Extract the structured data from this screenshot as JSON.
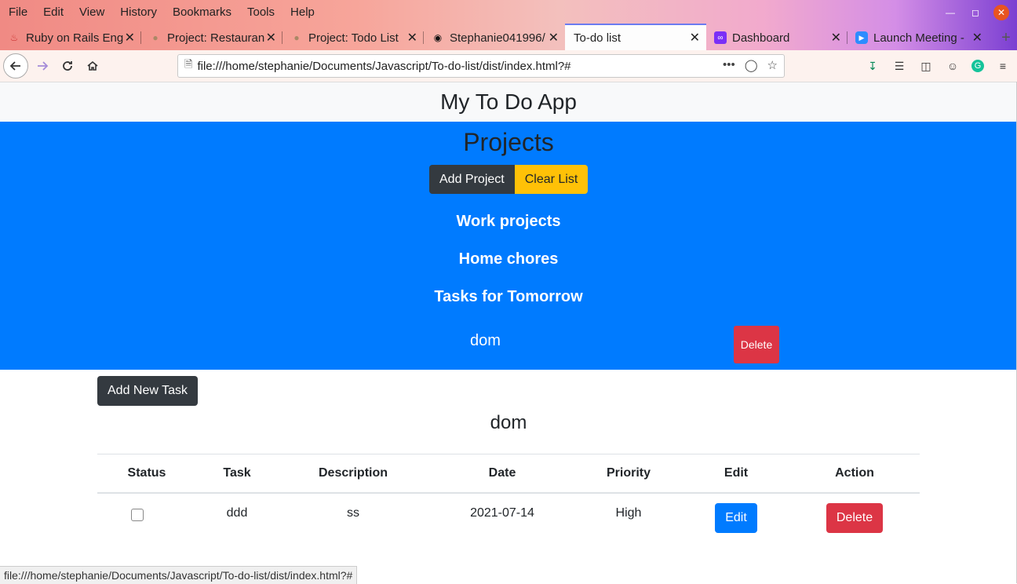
{
  "browser": {
    "menu": [
      "File",
      "Edit",
      "View",
      "History",
      "Bookmarks",
      "Tools",
      "Help"
    ],
    "tabs": [
      {
        "title": "Ruby on Rails Engi",
        "icon": "rails-icon"
      },
      {
        "title": "Project: Restaurant",
        "icon": "odin-icon"
      },
      {
        "title": "Project: Todo List",
        "icon": "odin-icon"
      },
      {
        "title": "Stephanie041996/",
        "icon": "github-icon"
      },
      {
        "title": "To-do list",
        "icon": "page-icon",
        "active": true
      },
      {
        "title": "Dashboard",
        "icon": "dashboard-icon"
      },
      {
        "title": "Launch Meeting -",
        "icon": "zoom-icon"
      }
    ],
    "url": "file:///home/stephanie/Documents/Javascript/To-do-list/dist/index.html?#",
    "status_url": "file:///home/stephanie/Documents/Javascript/To-do-list/dist/index.html?#"
  },
  "app": {
    "title": "My To Do App",
    "projects_heading": "Projects",
    "add_project_label": "Add Project",
    "clear_list_label": "Clear List",
    "projects": [
      "Work projects",
      "Home chores",
      "Tasks for Tomorrow"
    ],
    "current_project": "dom",
    "current_delete_label": "Delete",
    "add_task_label": "Add New Task",
    "task_heading": "dom",
    "table": {
      "headers": [
        "Status",
        "Task",
        "Description",
        "Date",
        "Priority",
        "Edit",
        "Action"
      ],
      "rows": [
        {
          "task": "ddd",
          "description": "ss",
          "date": "2021-07-14",
          "priority": "High",
          "edit": "Edit",
          "action": "Delete",
          "done": false
        }
      ]
    }
  },
  "colors": {
    "primary": "#007bff",
    "danger": "#dc3545",
    "warning": "#ffc107",
    "dark": "#343a40"
  }
}
